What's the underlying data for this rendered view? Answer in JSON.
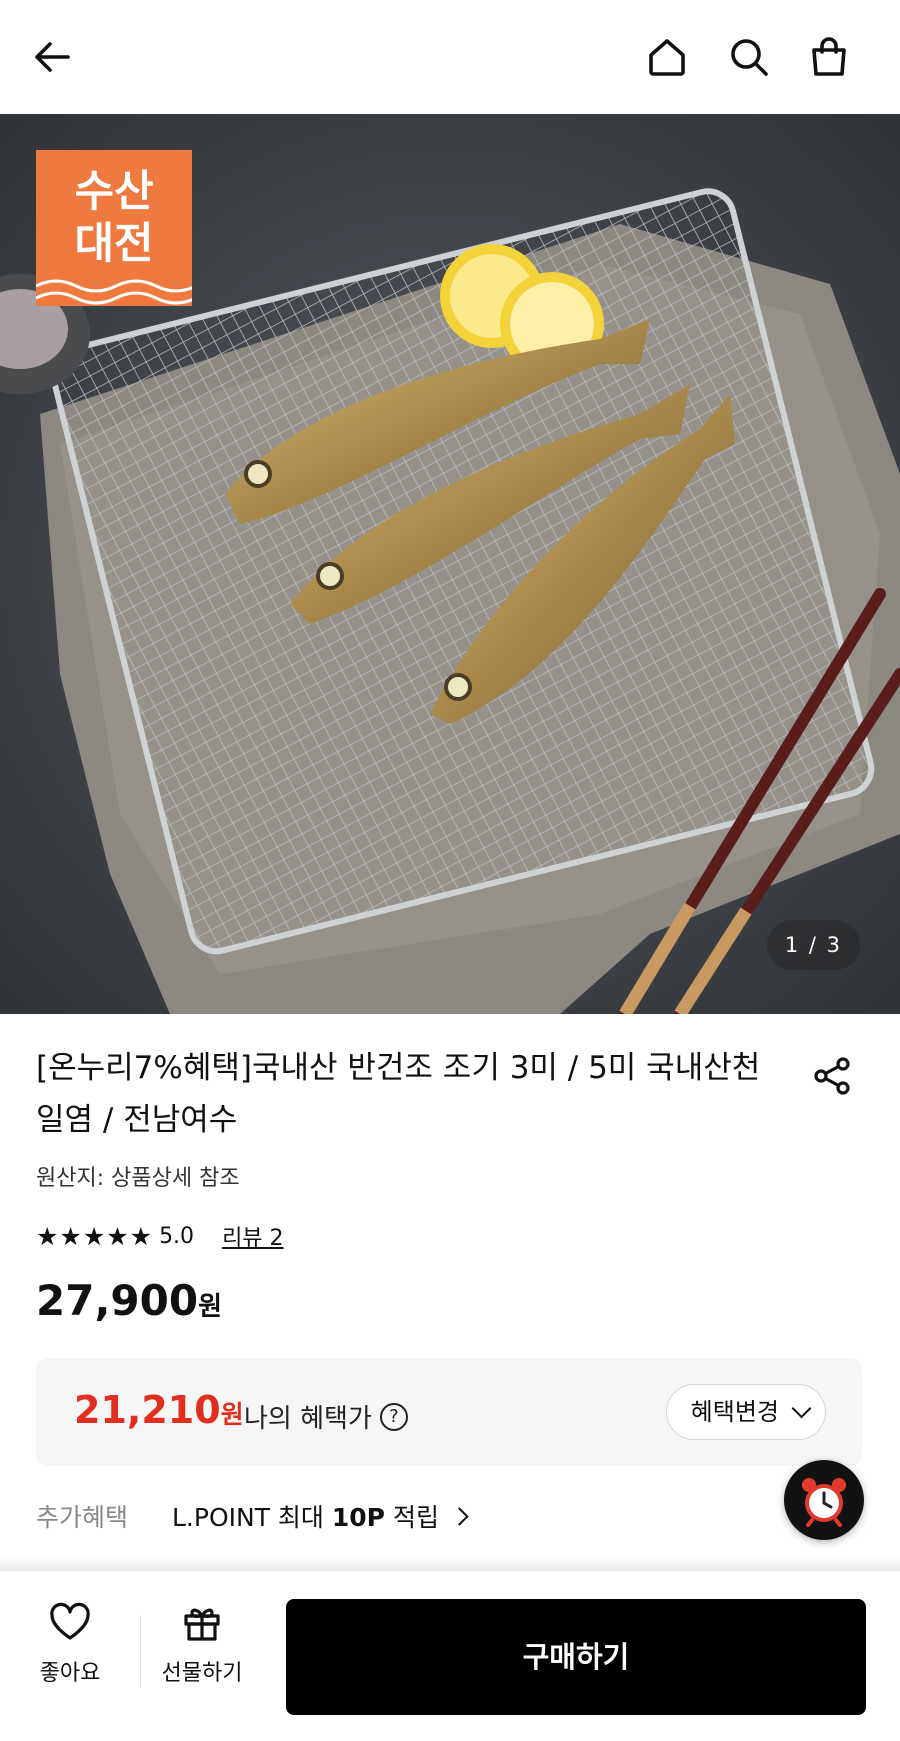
{
  "header": {
    "back_icon": "arrow-left-icon",
    "home_icon": "home-icon",
    "search_icon": "search-icon",
    "cart_icon": "shopping-bag-icon"
  },
  "hero": {
    "badge_line1": "수산",
    "badge_line2": "대전",
    "badge_color": "#ef7a3f",
    "counter": "1 / 3"
  },
  "product": {
    "title": "[온누리7%혜택]국내산 반건조 조기 3미 / 5미 국내산천일염 / 전남여수",
    "origin": "원산지: 상품상세 참조",
    "stars": "★★★★★",
    "rating": "5.0",
    "review_link": "리뷰 2",
    "price": "27,900",
    "price_unit": "원"
  },
  "benefit": {
    "price": "21,210",
    "price_unit": "원",
    "price_color": "#e02f1f",
    "label": "나의 혜택가",
    "help": "?",
    "change_button": "혜택변경"
  },
  "extra": {
    "key": "추가혜택",
    "value_prefix": "L.POINT 최대 ",
    "value_bold": "10P",
    "value_suffix": " 적립"
  },
  "bottom": {
    "like_label": "좋아요",
    "gift_label": "선물하기",
    "buy_label": "구매하기"
  }
}
